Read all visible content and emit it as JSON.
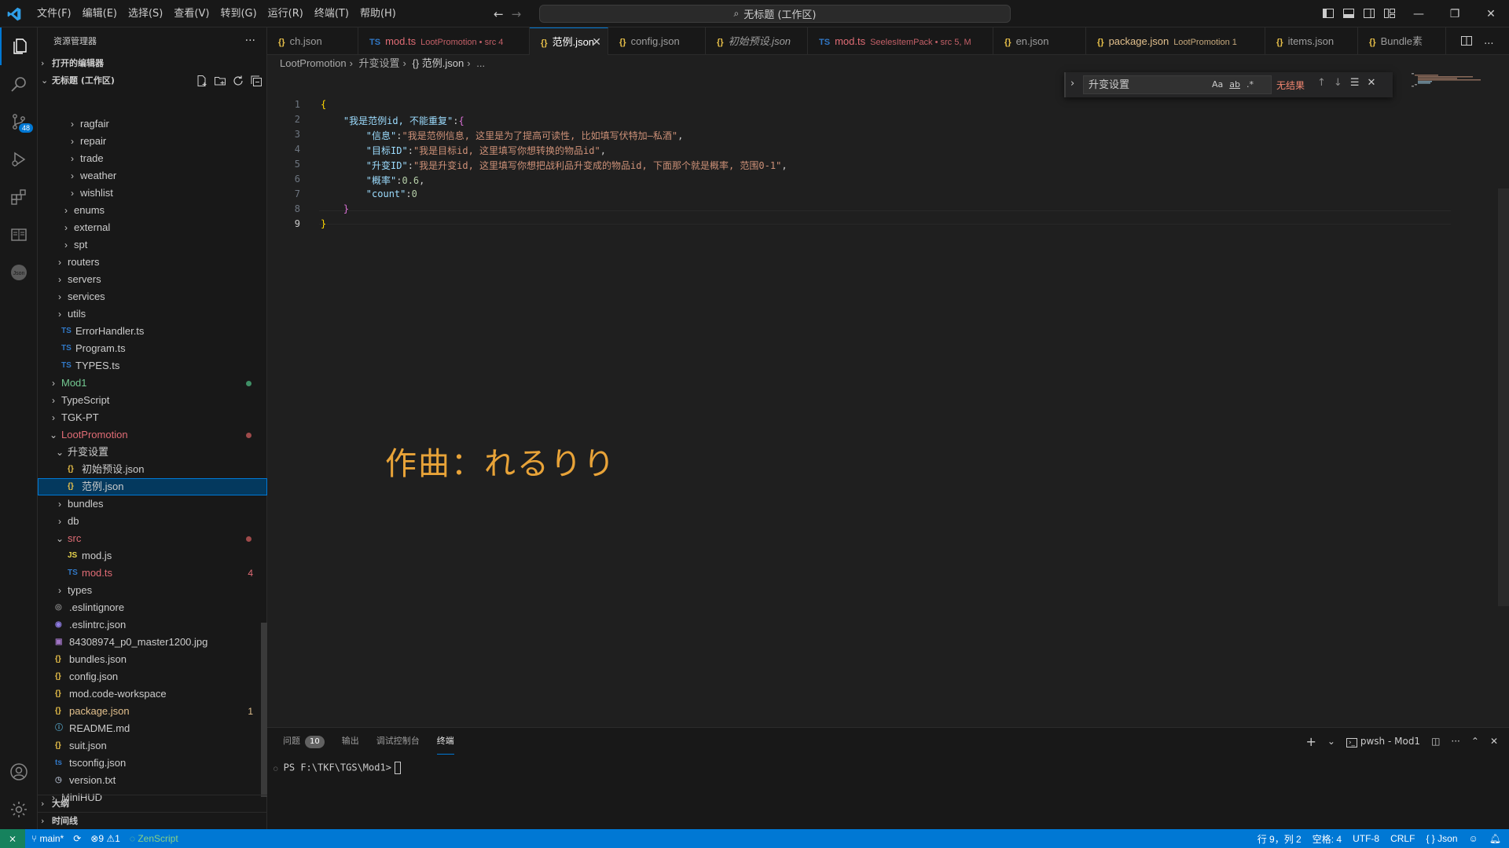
{
  "titlebar": {
    "menu": [
      "文件(F)",
      "编辑(E)",
      "选择(S)",
      "查看(V)",
      "转到(G)",
      "运行(R)",
      "终端(T)",
      "帮助(H)"
    ],
    "command_center": "无标题 (工作区)"
  },
  "activity_bar": {
    "scm_badge": "48",
    "items": [
      "explorer-icon",
      "search-icon",
      "source-control-icon",
      "run-debug-icon",
      "extensions-icon",
      "reading-icon",
      "json-icon",
      "account-icon",
      "settings-gear-icon"
    ]
  },
  "sidebar": {
    "title": "资源管理器",
    "more": "···",
    "open_editors": "打开的编辑器",
    "workspace": "无标题 (工作区)",
    "outline": "大纲",
    "timeline": "时间线",
    "tree": [
      {
        "label": "ragfair",
        "kind": "folder",
        "depth": 3
      },
      {
        "label": "repair",
        "kind": "folder",
        "depth": 3
      },
      {
        "label": "trade",
        "kind": "folder",
        "depth": 3
      },
      {
        "label": "weather",
        "kind": "folder",
        "depth": 3
      },
      {
        "label": "wishlist",
        "kind": "folder",
        "depth": 3
      },
      {
        "label": "enums",
        "kind": "folder",
        "depth": 2
      },
      {
        "label": "external",
        "kind": "folder",
        "depth": 2
      },
      {
        "label": "spt",
        "kind": "folder",
        "depth": 2
      },
      {
        "label": "routers",
        "kind": "folder",
        "depth": 1
      },
      {
        "label": "servers",
        "kind": "folder",
        "depth": 1
      },
      {
        "label": "services",
        "kind": "folder",
        "depth": 1
      },
      {
        "label": "utils",
        "kind": "folder",
        "depth": 1
      },
      {
        "label": "ErrorHandler.ts",
        "kind": "ts",
        "depth": 1
      },
      {
        "label": "Program.ts",
        "kind": "ts",
        "depth": 1
      },
      {
        "label": "TYPES.ts",
        "kind": "ts",
        "depth": 1
      },
      {
        "label": "Mod1",
        "kind": "root",
        "depth": 0,
        "color": "#73c991",
        "dot": "#3f8f66"
      },
      {
        "label": "TypeScript",
        "kind": "root",
        "depth": 0
      },
      {
        "label": "TGK-PT",
        "kind": "root",
        "depth": 0
      },
      {
        "label": "LootPromotion",
        "kind": "root-open",
        "depth": 0,
        "color": "#e06c75",
        "dot": "#9e4a4a"
      },
      {
        "label": "升变设置",
        "kind": "folder-open",
        "depth": 1
      },
      {
        "label": "初始预设.json",
        "kind": "json",
        "depth": 2
      },
      {
        "label": "范例.json",
        "kind": "json",
        "depth": 2,
        "selected": true
      },
      {
        "label": "bundles",
        "kind": "folder",
        "depth": 1
      },
      {
        "label": "db",
        "kind": "folder",
        "depth": 1
      },
      {
        "label": "src",
        "kind": "folder-open",
        "depth": 1,
        "color": "#e06c75",
        "dot": "#9e4a4a"
      },
      {
        "label": "mod.js",
        "kind": "js",
        "depth": 2
      },
      {
        "label": "mod.ts",
        "kind": "ts",
        "depth": 2,
        "color": "#e06c75",
        "count": "4"
      },
      {
        "label": "types",
        "kind": "folder",
        "depth": 1
      },
      {
        "label": ".eslintignore",
        "kind": "eslintignore",
        "depth": 0
      },
      {
        "label": ".eslintrc.json",
        "kind": "eslint",
        "depth": 0
      },
      {
        "label": "84308974_p0_master1200.jpg",
        "kind": "image",
        "depth": 0
      },
      {
        "label": "bundles.json",
        "kind": "json",
        "depth": 0
      },
      {
        "label": "config.json",
        "kind": "json",
        "depth": 0
      },
      {
        "label": "mod.code-workspace",
        "kind": "json",
        "depth": 0
      },
      {
        "label": "package.json",
        "kind": "json",
        "depth": 0,
        "color": "#e2c08d",
        "count": "1",
        "count_color": "#e2c08d"
      },
      {
        "label": "README.md",
        "kind": "info",
        "depth": 0
      },
      {
        "label": "suit.json",
        "kind": "json",
        "depth": 0
      },
      {
        "label": "tsconfig.json",
        "kind": "tsconfig",
        "depth": 0
      },
      {
        "label": "version.txt",
        "kind": "txt",
        "depth": 0
      },
      {
        "label": "MiniHUD",
        "kind": "root",
        "depth": 0
      }
    ]
  },
  "tabs": [
    {
      "icon": "{}",
      "label": "ch.json",
      "sub": ""
    },
    {
      "icon": "TS",
      "label": "mod.ts",
      "sub": "LootPromotion • src 4",
      "color": "#e06c75"
    },
    {
      "icon": "{}",
      "label": "范例.json",
      "sub": "",
      "active": true
    },
    {
      "icon": "{}",
      "label": "config.json",
      "sub": ""
    },
    {
      "icon": "{}",
      "label": "初始预设.json",
      "sub": "",
      "italic": true
    },
    {
      "icon": "TS",
      "label": "mod.ts",
      "sub": "SeelesItemPack • src 5, M",
      "color": "#e06c75"
    },
    {
      "icon": "{}",
      "label": "en.json",
      "sub": ""
    },
    {
      "icon": "{}",
      "label": "package.json",
      "sub": "LootPromotion 1",
      "color": "#e2c08d"
    },
    {
      "icon": "{}",
      "label": "items.json",
      "sub": ""
    },
    {
      "icon": "{}",
      "label": "Bundle素",
      "sub": ""
    }
  ],
  "breadcrumb": [
    "LootPromotion",
    "升变设置",
    "{} 范例.json",
    "..."
  ],
  "find": {
    "query": "升变设置",
    "opt_case": "Aa",
    "opt_word": "ab",
    "opt_regex": ".*",
    "result": "无结果"
  },
  "editor": {
    "lines": [
      {
        "n": "1",
        "text": "{"
      },
      {
        "n": "2",
        "text": "    \"我是范例id, 不能重复\":{"
      },
      {
        "n": "3",
        "text": "        \"信息\":\"我是范例信息, 这里是为了提高可读性, 比如填写伏特加—私酒\","
      },
      {
        "n": "4",
        "text": "        \"目标ID\":\"我是目标id, 这里填写你想转换的物品id\","
      },
      {
        "n": "5",
        "text": "        \"升变ID\":\"我是升变id, 这里填写你想把战利品升变成的物品id, 下面那个就是概率, 范围0-1\","
      },
      {
        "n": "6",
        "text": "        \"概率\":0.6,"
      },
      {
        "n": "7",
        "text": "        \"count\":0"
      },
      {
        "n": "8",
        "text": "    }"
      },
      {
        "n": "9",
        "text": "}"
      }
    ],
    "overlay": "作曲：れるりり"
  },
  "panel": {
    "tabs": [
      "问题",
      "输出",
      "调试控制台",
      "终端"
    ],
    "problems_count": "10",
    "active_tab": "终端",
    "terminal_name": "pwsh - Mod1",
    "prompt": "PS F:\\TKF\\TGS\\Mod1>"
  },
  "statusbar": {
    "branch": "main*",
    "errors": "9",
    "warnings": "1",
    "zenscript": "ZenScript",
    "position": "行 9，列 2",
    "spaces": "空格: 4",
    "encoding": "UTF-8",
    "eol": "CRLF",
    "language": "Json"
  },
  "colors": {
    "accent": "#0078d4",
    "statusbar": "#0078d4",
    "overlay_text": "#e8a338"
  }
}
